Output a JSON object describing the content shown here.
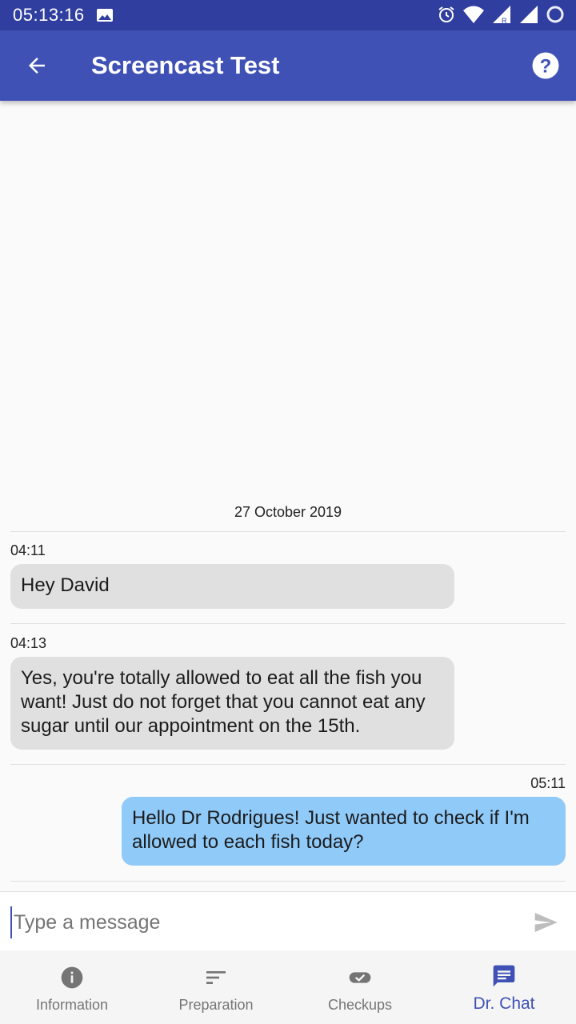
{
  "status_bar": {
    "time": "05:13:16"
  },
  "app_bar": {
    "title": "Screencast Test"
  },
  "chat": {
    "date": "27 October 2019",
    "messages": [
      {
        "time": "04:11",
        "text": "Hey David",
        "direction": "received"
      },
      {
        "time": "04:13",
        "text": "Yes, you're totally allowed to eat all the fish you want! Just do not forget that you cannot eat any sugar until our appointment on the 15th.",
        "direction": "received"
      },
      {
        "time": "05:11",
        "text": "Hello Dr Rodrigues! Just wanted to check if I'm allowed to each fish today?",
        "direction": "sent"
      }
    ]
  },
  "composer": {
    "placeholder": "Type a message",
    "value": ""
  },
  "bottom_nav": {
    "items": [
      {
        "label": "Information",
        "icon": "info-icon"
      },
      {
        "label": "Preparation",
        "icon": "sort-icon"
      },
      {
        "label": "Checkups",
        "icon": "pill-check-icon"
      },
      {
        "label": "Dr. Chat",
        "icon": "chat-icon"
      }
    ],
    "active": "Dr. Chat"
  },
  "colors": {
    "primary": "#3f51b5",
    "primary_dark": "#303f9f",
    "received_bubble": "#e0e0e0",
    "sent_bubble": "#90caf9"
  }
}
